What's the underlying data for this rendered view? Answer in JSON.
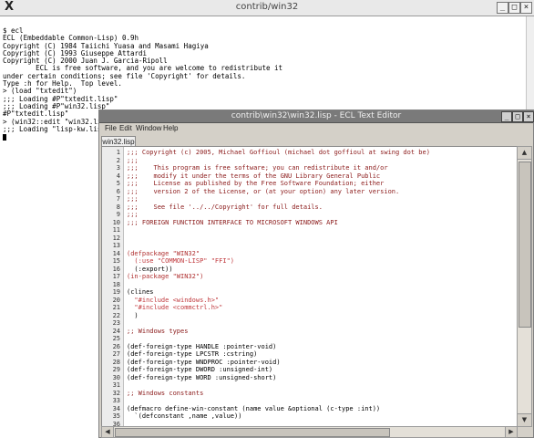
{
  "terminal": {
    "title": "contrib/win32",
    "lines": [
      "$ ecl",
      "ECL (Embeddable Common-Lisp) 0.9h",
      "Copyright (C) 1984 Taiichi Yuasa and Masami Hagiya",
      "Copyright (C) 1993 Giuseppe Attardi",
      "Copyright (C) 2000 Juan J. Garcia-Ripoll",
      "        ECL is free software, and you are welcome to redistribute it",
      "under certain conditions; see file 'Copyright' for details.",
      "Type :h for Help.  Top level.",
      "> (load \"txtedit\")",
      ";;; Loading #P\"txtedit.lisp\"",
      ";;; Loading #P\"win32.lisp\"",
      "#P\"txtedit.lisp\"",
      "> (win32::edit \"win32.lisp\")",
      ";;; Loading \"lisp-kw.lisp\""
    ]
  },
  "editor": {
    "title": "contrib\\win32\\win32.lisp - ECL Text Editor",
    "menu": [
      "File",
      "Edit",
      "Window",
      "Help"
    ],
    "tab": "win32.lisp",
    "lines": [
      {
        "n": "1",
        "t": ";;; Copyright (c) 2005, Michael Goffioul (michael dot goffioul at swing dot be)",
        "c": "comment"
      },
      {
        "n": "2",
        "t": ";;;",
        "c": "comment"
      },
      {
        "n": "3",
        "t": ";;;    This program is free software; you can redistribute it and/or",
        "c": "comment"
      },
      {
        "n": "4",
        "t": ";;;    modify it under the terms of the GNU Library General Public",
        "c": "comment"
      },
      {
        "n": "5",
        "t": ";;;    License as published by the Free Software Foundation; either",
        "c": "comment"
      },
      {
        "n": "6",
        "t": ";;;    version 2 of the License, or (at your option) any later version.",
        "c": "comment"
      },
      {
        "n": "7",
        "t": ";;;",
        "c": "comment"
      },
      {
        "n": "8",
        "t": ";;;    See file '../../Copyright' for full details.",
        "c": "comment"
      },
      {
        "n": "9",
        "t": ";;;",
        "c": "comment"
      },
      {
        "n": "10",
        "t": ";;; FOREIGN FUNCTION INTERFACE TO MICROSOFT WINDOWS API",
        "c": "comment"
      },
      {
        "n": "11",
        "t": "",
        "c": "norm"
      },
      {
        "n": "12",
        "t": "",
        "c": "norm"
      },
      {
        "n": "13",
        "t": "",
        "c": "norm"
      },
      {
        "n": "14",
        "t": "(defpackage \"WIN32\"",
        "c": "kw"
      },
      {
        "n": "15",
        "t": "  (:use \"COMMON-LISP\" \"FFI\")",
        "c": "str"
      },
      {
        "n": "16",
        "t": "  (:export))",
        "c": "norm"
      },
      {
        "n": "17",
        "t": "(in-package \"WIN32\")",
        "c": "kw"
      },
      {
        "n": "18",
        "t": "",
        "c": "norm"
      },
      {
        "n": "19",
        "t": "(clines",
        "c": "norm"
      },
      {
        "n": "20",
        "t": "  \"#include <windows.h>\"",
        "c": "str"
      },
      {
        "n": "21",
        "t": "  \"#include <commctrl.h>\"",
        "c": "str"
      },
      {
        "n": "22",
        "t": "  )",
        "c": "norm"
      },
      {
        "n": "23",
        "t": "",
        "c": "norm"
      },
      {
        "n": "24",
        "t": ";; Windows types",
        "c": "comment"
      },
      {
        "n": "25",
        "t": "",
        "c": "norm"
      },
      {
        "n": "26",
        "t": "(def-foreign-type HANDLE :pointer-void)",
        "c": "norm"
      },
      {
        "n": "27",
        "t": "(def-foreign-type LPCSTR :cstring)",
        "c": "norm"
      },
      {
        "n": "28",
        "t": "(def-foreign-type WNDPROC :pointer-void)",
        "c": "norm"
      },
      {
        "n": "29",
        "t": "(def-foreign-type DWORD :unsigned-int)",
        "c": "norm"
      },
      {
        "n": "30",
        "t": "(def-foreign-type WORD :unsigned-short)",
        "c": "norm"
      },
      {
        "n": "31",
        "t": "",
        "c": "norm"
      },
      {
        "n": "32",
        "t": ";; Windows constants",
        "c": "comment"
      },
      {
        "n": "33",
        "t": "",
        "c": "norm"
      },
      {
        "n": "34",
        "t": "(defmacro define-win-constant (name value &optional (c-type :int))",
        "c": "norm"
      },
      {
        "n": "35",
        "t": "  `(defconstant ,name ,value))",
        "c": "norm"
      },
      {
        "n": "36",
        "t": "",
        "c": "norm"
      }
    ]
  },
  "icons": {
    "x_logo": "x-window-logo-icon",
    "minimize": "minimize-icon",
    "maximize": "maximize-icon",
    "close": "close-icon"
  },
  "colors": {
    "comment": "#8b1a1a",
    "keyword": "#b03030",
    "string": "#c0383c"
  }
}
